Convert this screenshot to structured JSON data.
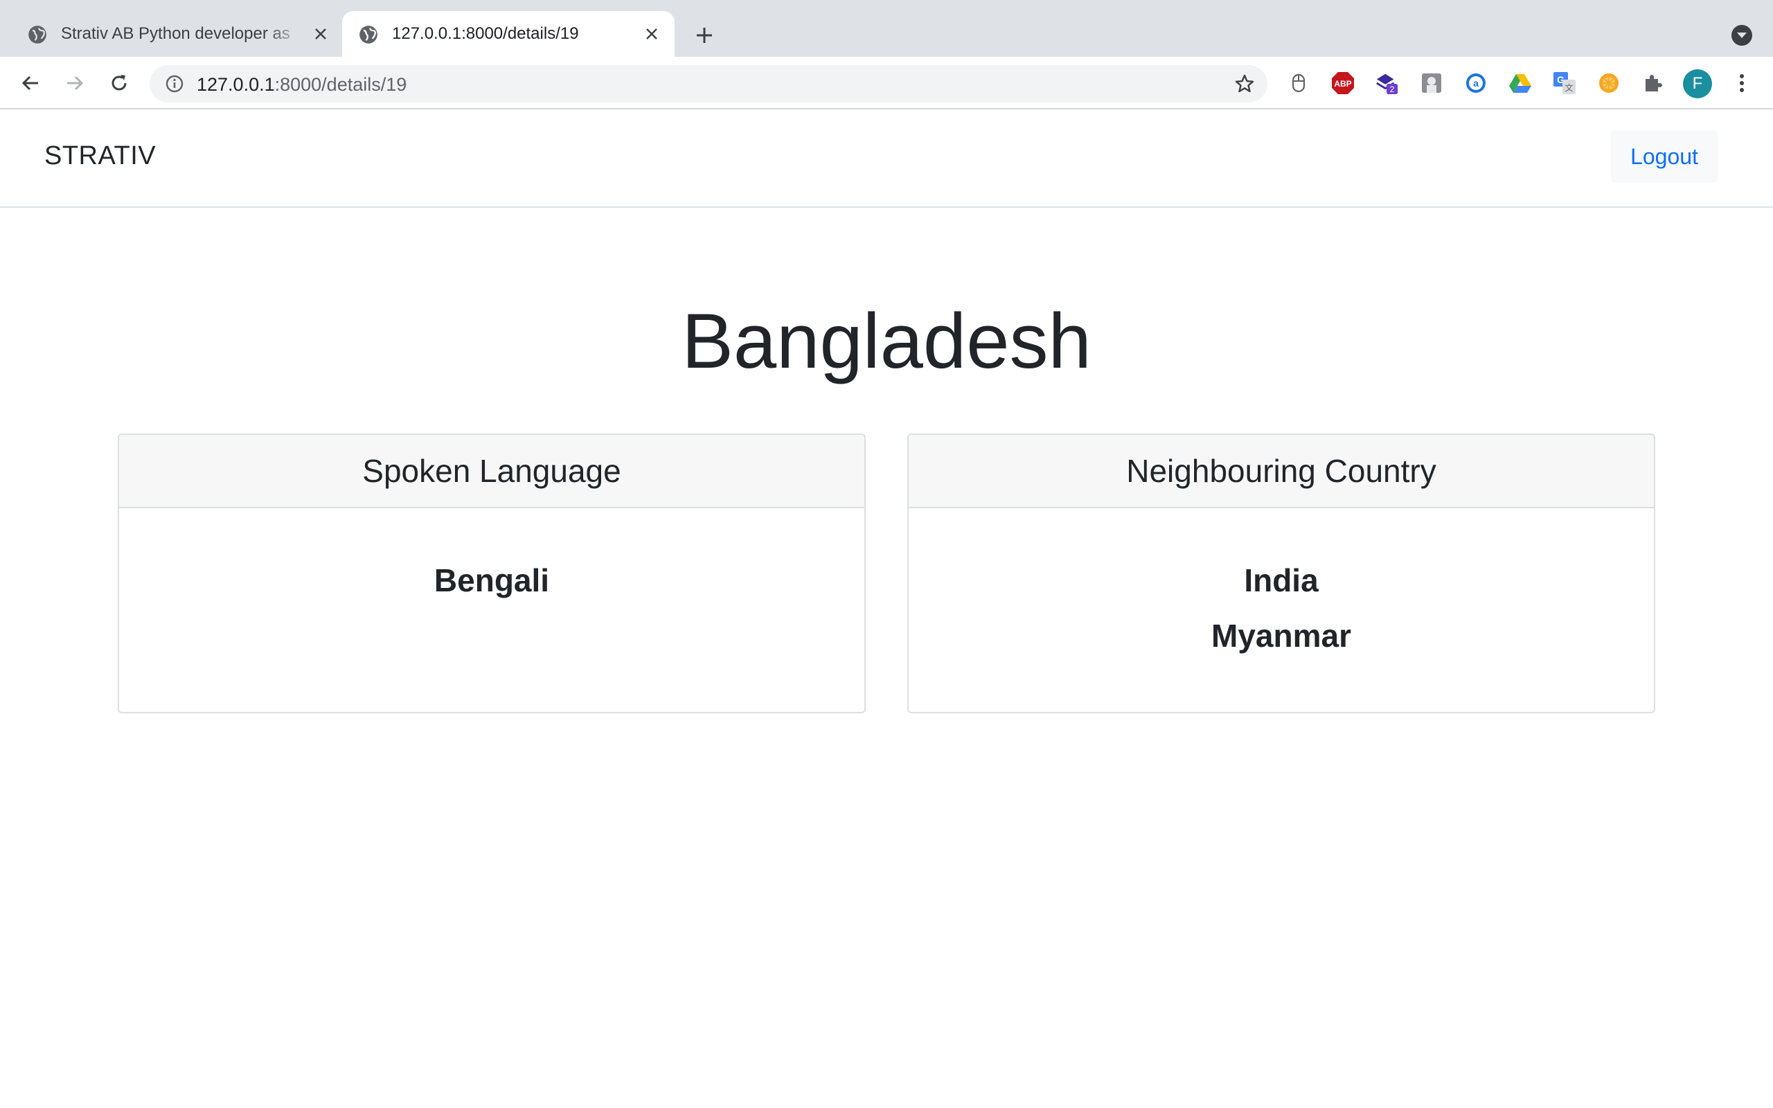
{
  "browser": {
    "tabs": [
      {
        "title": "Strativ AB Python developer as",
        "active": false
      },
      {
        "title": "127.0.0.1:8000/details/19",
        "active": true
      }
    ],
    "url_host": "127.0.0.1",
    "url_path": ":8000/details/19",
    "profile_initial": "F",
    "extensions": [
      "mouse-icon",
      "adblock-icon",
      "stack-icon",
      "reader-icon",
      "a-icon",
      "drive-icon",
      "translate-icon",
      "orange-icon",
      "puzzle-icon"
    ],
    "extension_badge": "2",
    "adblock_label": "ABP"
  },
  "navbar": {
    "brand": "STRATIV",
    "logout_label": "Logout"
  },
  "main": {
    "country": "Bangladesh",
    "languages_card": {
      "header": "Spoken Language",
      "items": [
        "Bengali"
      ]
    },
    "neighbours_card": {
      "header": "Neighbouring Country",
      "items": [
        "India",
        "Myanmar"
      ]
    }
  },
  "colors": {
    "link": "#0d6efd",
    "tabstrip": "#dee1e6",
    "card_header_bg": "#f7f7f7",
    "profile_bg": "#1a8fa0"
  }
}
